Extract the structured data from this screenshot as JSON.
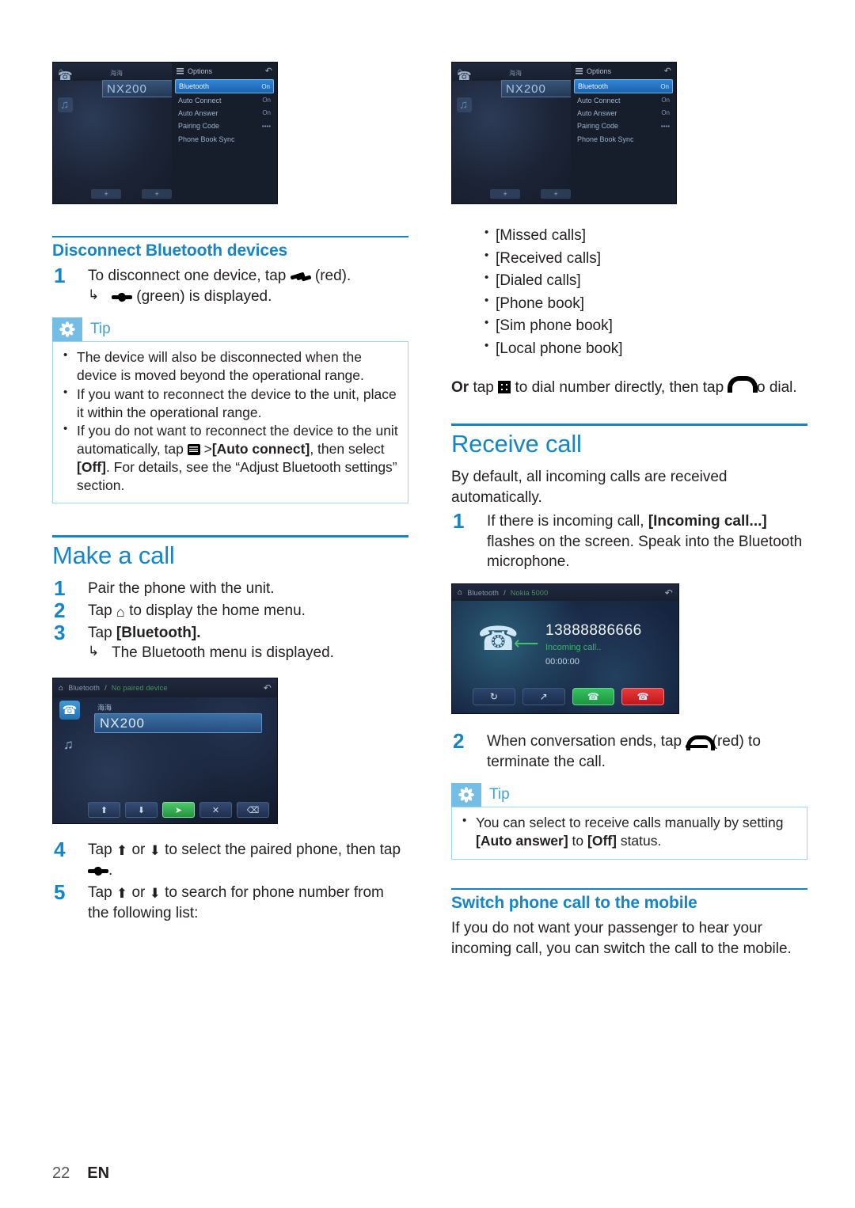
{
  "colors": {
    "heading_blue": "#1585c8",
    "tip_badge": "#74bee6",
    "tip_border": "#9fd4ee",
    "text": "#231f20"
  },
  "device_shots": {
    "options_menu": {
      "breadcrumb_home": "⌂",
      "panel_title": "Options",
      "back_icon": "back-arrow-icon",
      "device_label_small": "海海",
      "device_name": "NX200",
      "rows": [
        {
          "label": "Bluetooth",
          "value": "On",
          "selected": true
        },
        {
          "label": "Auto Connect",
          "value": "On",
          "selected": false
        },
        {
          "label": "Auto Answer",
          "value": "On",
          "selected": false
        },
        {
          "label": "Pairing Code",
          "value": "••••",
          "selected": false
        },
        {
          "label": "Phone Book Sync",
          "value": "",
          "selected": false
        }
      ]
    },
    "paired_device": {
      "breadcrumb_1": "Bluetooth",
      "breadcrumb_sep": "/",
      "breadcrumb_2": "No paired device",
      "device_label_small": "海海",
      "device_name": "NX200",
      "toolbar": [
        {
          "icon": "⬆",
          "name": "scroll-up-button",
          "style": ""
        },
        {
          "icon": "⬇",
          "name": "scroll-down-button",
          "style": ""
        },
        {
          "icon": "➤",
          "name": "connect-button",
          "style": "green"
        },
        {
          "icon": "✕",
          "name": "disconnect-button",
          "style": ""
        },
        {
          "icon": "Ὕ1",
          "name": "delete-button",
          "style": ""
        }
      ]
    },
    "incoming_call": {
      "breadcrumb_1": "Bluetooth",
      "breadcrumb_sep": "/",
      "breadcrumb_2": "Nokia 5000",
      "number": "13888886666",
      "status": "Incoming call..",
      "timer": "00:00:00",
      "buttons": [
        {
          "icon": "↻",
          "name": "sync-button",
          "style": ""
        },
        {
          "icon": "↗",
          "name": "transfer-call-button",
          "style": ""
        },
        {
          "icon": "☎",
          "name": "answer-call-button",
          "style": "green"
        },
        {
          "icon": "☎",
          "name": "end-call-button",
          "style": "red"
        }
      ]
    }
  },
  "left_column": {
    "disconnect": {
      "heading": "Disconnect Bluetooth devices",
      "step1_num": "1",
      "step1_a": "To disconnect one device, tap ",
      "step1_b": " (red).",
      "result_a": " ",
      "result_b": " (green) is displayed."
    },
    "tip": {
      "title": "Tip",
      "bullets": [
        {
          "parts": [
            {
              "t": "The device will also be disconnected when the device is moved beyond the operational range."
            }
          ]
        },
        {
          "parts": [
            {
              "t": "If you want to reconnect the device to the unit, place it within the operational range."
            }
          ]
        },
        {
          "parts": [
            {
              "t": "If you do not want to reconnect the device to the unit automatically, tap "
            },
            {
              "icon": "menu-icon"
            },
            {
              "t": " >"
            },
            {
              "t": "[Auto connect]",
              "bold": true
            },
            {
              "t": ", then select "
            },
            {
              "t": "[Off]",
              "bold": true
            },
            {
              "t": ". For details, see the “Adjust Bluetooth settings” section."
            }
          ]
        }
      ]
    },
    "make_a_call": {
      "heading": "Make a call",
      "steps": [
        {
          "num": "1",
          "text": "Pair the phone with the unit."
        },
        {
          "num": "2",
          "text_a": "Tap ",
          "icon": "home-icon",
          "text_b": " to display the home menu."
        },
        {
          "num": "3",
          "text_a": "Tap ",
          "bold": "[Bluetooth].",
          "result": "The Bluetooth menu is displayed."
        },
        {
          "num": "4",
          "text_a": "Tap ",
          "icon_up": "up-arrow-icon",
          "text_mid": " or ",
          "icon_dn": "down-arrow-icon",
          "text_b": " to select the paired phone, then tap ",
          "icon_end": "connect-icon",
          "text_c": "."
        },
        {
          "num": "5",
          "text_a": "Tap ",
          "icon_up": "up-arrow-icon",
          "text_mid": " or ",
          "icon_dn": "down-arrow-icon",
          "text_b": " to search for phone number from the following list:"
        }
      ]
    }
  },
  "right_column": {
    "phone_lists": [
      "[Missed calls]",
      "[Received calls]",
      "[Dialed calls]",
      "[Phone book]",
      "[Sim phone book]",
      "[Local phone book]"
    ],
    "or_dial": {
      "or": "Or",
      "a": " tap ",
      "b": " to dial number directly, then tap ",
      "c": " to dial."
    },
    "receive_call": {
      "heading": "Receive call",
      "intro": "By default, all incoming calls are received automatically.",
      "step1_num": "1",
      "step1_a": "If there is incoming call, ",
      "step1_bold": "[Incoming call...]",
      "step1_b": " flashes on the screen. Speak into the Bluetooth microphone.",
      "step2_num": "2",
      "step2_a": "When conversation ends, tap ",
      "step2_b": " (red) to terminate the call."
    },
    "tip": {
      "title": "Tip",
      "bullets": [
        {
          "parts": [
            {
              "t": "You can select to receive calls manually by setting "
            },
            {
              "t": "[Auto answer]",
              "bold": true
            },
            {
              "t": " to "
            },
            {
              "t": "[Off]",
              "bold": true
            },
            {
              "t": " status."
            }
          ]
        }
      ]
    },
    "switch_call": {
      "heading": "Switch phone call to the mobile",
      "body": "If you do not want your passenger to hear your incoming call, you can switch the call to the mobile."
    }
  },
  "footer": {
    "page_number": "22",
    "language": "EN"
  }
}
